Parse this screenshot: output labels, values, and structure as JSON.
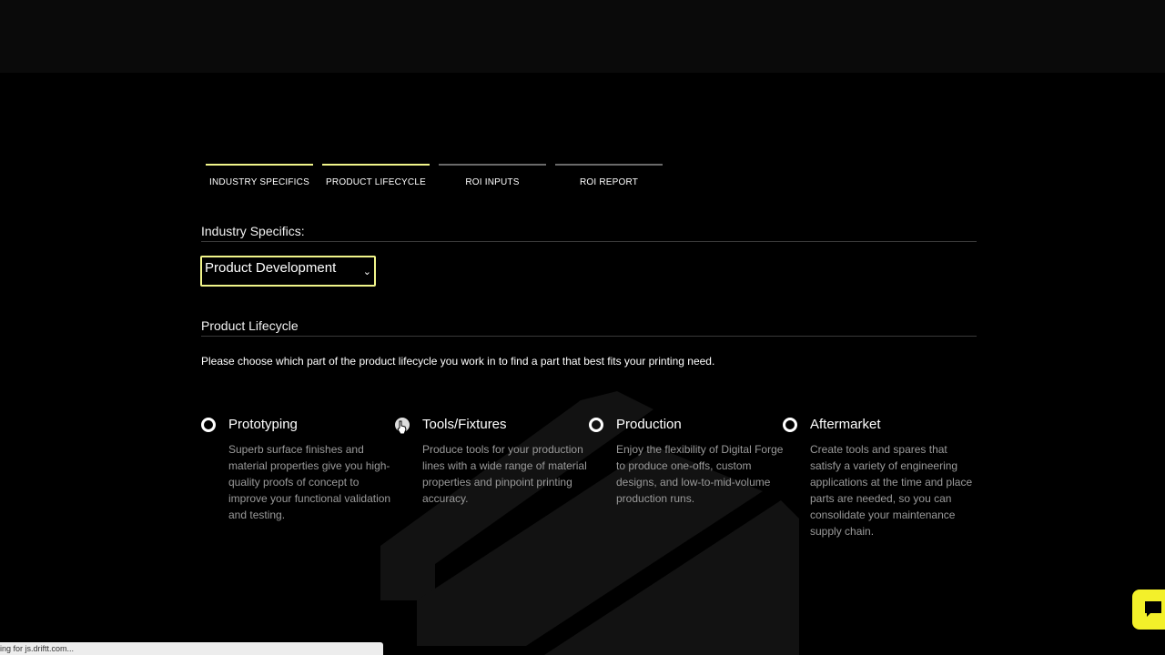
{
  "tabs": [
    {
      "label": "INDUSTRY SPECIFICS",
      "active": true
    },
    {
      "label": "PRODUCT LIFECYCLE",
      "active": true
    },
    {
      "label": "ROI INPUTS",
      "active": false
    },
    {
      "label": "ROI REPORT",
      "active": false
    }
  ],
  "industry": {
    "heading": "Industry Specifics:",
    "select_value": "Product Development"
  },
  "lifecycle": {
    "heading": "Product Lifecycle",
    "description": "Please choose which part of the product lifecycle you work in to find a part that best fits your printing need.",
    "options": [
      {
        "label": "Prototyping",
        "text": "Superb surface finishes and material properties give you high-quality proofs of concept to improve your functional validation and testing."
      },
      {
        "label": "Tools/Fixtures",
        "text": "Produce tools for your production lines with a wide range of material properties and pinpoint printing accuracy."
      },
      {
        "label": "Production",
        "text": "Enjoy the flexibility of Digital Forge to produce one-offs, custom designs, and low-to-mid-volume production runs."
      },
      {
        "label": "Aftermarket",
        "text": "Create tools and spares that satisfy a variety of engineering applications at the time and place parts are needed, so you can consolidate your maintenance supply chain."
      }
    ]
  },
  "status_bar": {
    "text": "ing for js.driftt.com..."
  },
  "colors": {
    "accent": "#f1f58a",
    "chat": "#f3f02a",
    "background": "#000000"
  },
  "icons": {
    "select": "chevron-down-icon",
    "chat": "chat-icon",
    "cursor": "pointer-cursor-icon"
  }
}
